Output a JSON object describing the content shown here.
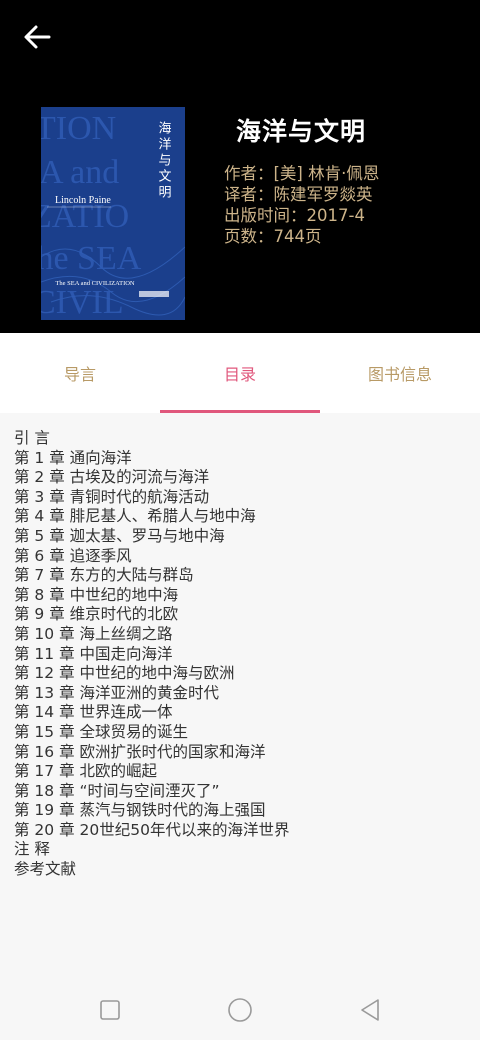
{
  "header": {
    "back_icon": "arrow-left-icon",
    "book": {
      "title": "海洋与文明",
      "author": "作者：[美] 林肯·佩恩",
      "translator": "译者：陈建军罗燚英",
      "publish_date": "出版时间：2017-4",
      "pages": "页数：744页"
    },
    "cover": {
      "title_cn": "海洋与文明",
      "author_en": "Lincoln Paine",
      "subtitle_en": "The SEA and CIVILIZATION",
      "bg_words": [
        "TION",
        "A and",
        "ZATIO",
        "the SEA",
        "CIVIL"
      ],
      "colors": {
        "background": "#1b3f8c",
        "text": "#ffffff"
      }
    }
  },
  "tabs": [
    {
      "label": "导言",
      "active": false
    },
    {
      "label": "目录",
      "active": true
    },
    {
      "label": "图书信息",
      "active": false
    }
  ],
  "toc": [
    "引 言",
    "第 1 章 通向海洋",
    "第 2 章 古埃及的河流与海洋",
    "第 3 章 青铜时代的航海活动",
    "第 4 章 腓尼基人、希腊人与地中海",
    "第 5 章 迦太基、罗马与地中海",
    "第 6 章 追逐季风",
    "第 7 章 东方的大陆与群岛",
    "第 8 章 中世纪的地中海",
    "第 9 章 维京时代的北欧",
    "第 10 章 海上丝绸之路",
    "第 11 章 中国走向海洋",
    "第 12 章 中世纪的地中海与欧洲",
    "第 13 章 海洋亚洲的黄金时代",
    "第 14 章 世界连成一体",
    "第 15 章 全球贸易的诞生",
    "第 16 章 欧洲扩张时代的国家和海洋",
    "第 17 章 北欧的崛起",
    "第 18 章 “时间与空间湮灭了”",
    "第 19 章 蒸汽与钢铁时代的海上强国",
    "第 20 章 20世纪50年代以来的海洋世界",
    "注 释",
    "参考文献"
  ],
  "navbar": {
    "icons": [
      "square-recents-icon",
      "circle-home-icon",
      "triangle-back-icon"
    ]
  },
  "colors": {
    "header_bg": "#000000",
    "meta_text": "#cdb48a",
    "tab_inactive": "#b89a66",
    "tab_active": "#e0577c",
    "content_bg": "#f7f7f7",
    "toc_text": "#333333"
  }
}
